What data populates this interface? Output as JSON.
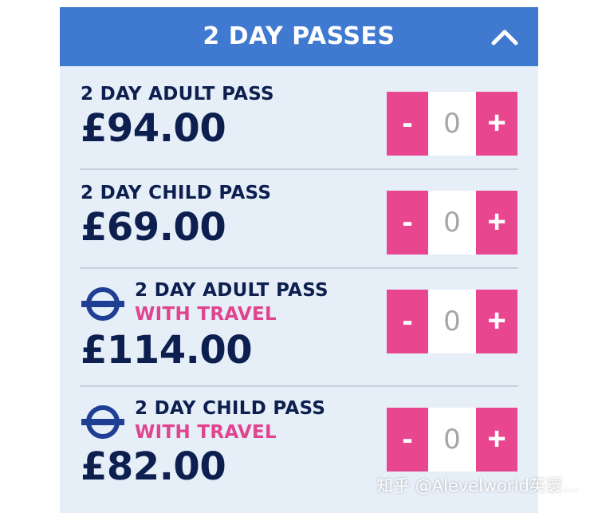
{
  "header": {
    "title": "2 DAY PASSES",
    "collapse_icon": "chevron-up-icon"
  },
  "passes": [
    {
      "name": "2 DAY ADULT PASS",
      "travel": "",
      "price": "£94.00",
      "quantity": "0",
      "minus": "-",
      "plus": "+"
    },
    {
      "name": "2 DAY CHILD PASS",
      "travel": "",
      "price": "£69.00",
      "quantity": "0",
      "minus": "-",
      "plus": "+"
    },
    {
      "name": "2 DAY ADULT PASS",
      "travel": "WITH TRAVEL",
      "price": "£114.00",
      "quantity": "0",
      "minus": "-",
      "plus": "+",
      "icon": "underground-roundel-icon"
    },
    {
      "name": "2 DAY CHILD PASS",
      "travel": "WITH TRAVEL",
      "price": "£82.00",
      "quantity": "0",
      "minus": "-",
      "plus": "+",
      "icon": "underground-roundel-icon"
    }
  ],
  "watermark": "知乎 @Alevelworld英寰...",
  "colors": {
    "header_bg": "#3f7ad0",
    "panel_bg": "#e6eef8",
    "text_navy": "#0d1f4f",
    "accent_pink": "#e8478f",
    "travel_pink": "#e0448e"
  }
}
